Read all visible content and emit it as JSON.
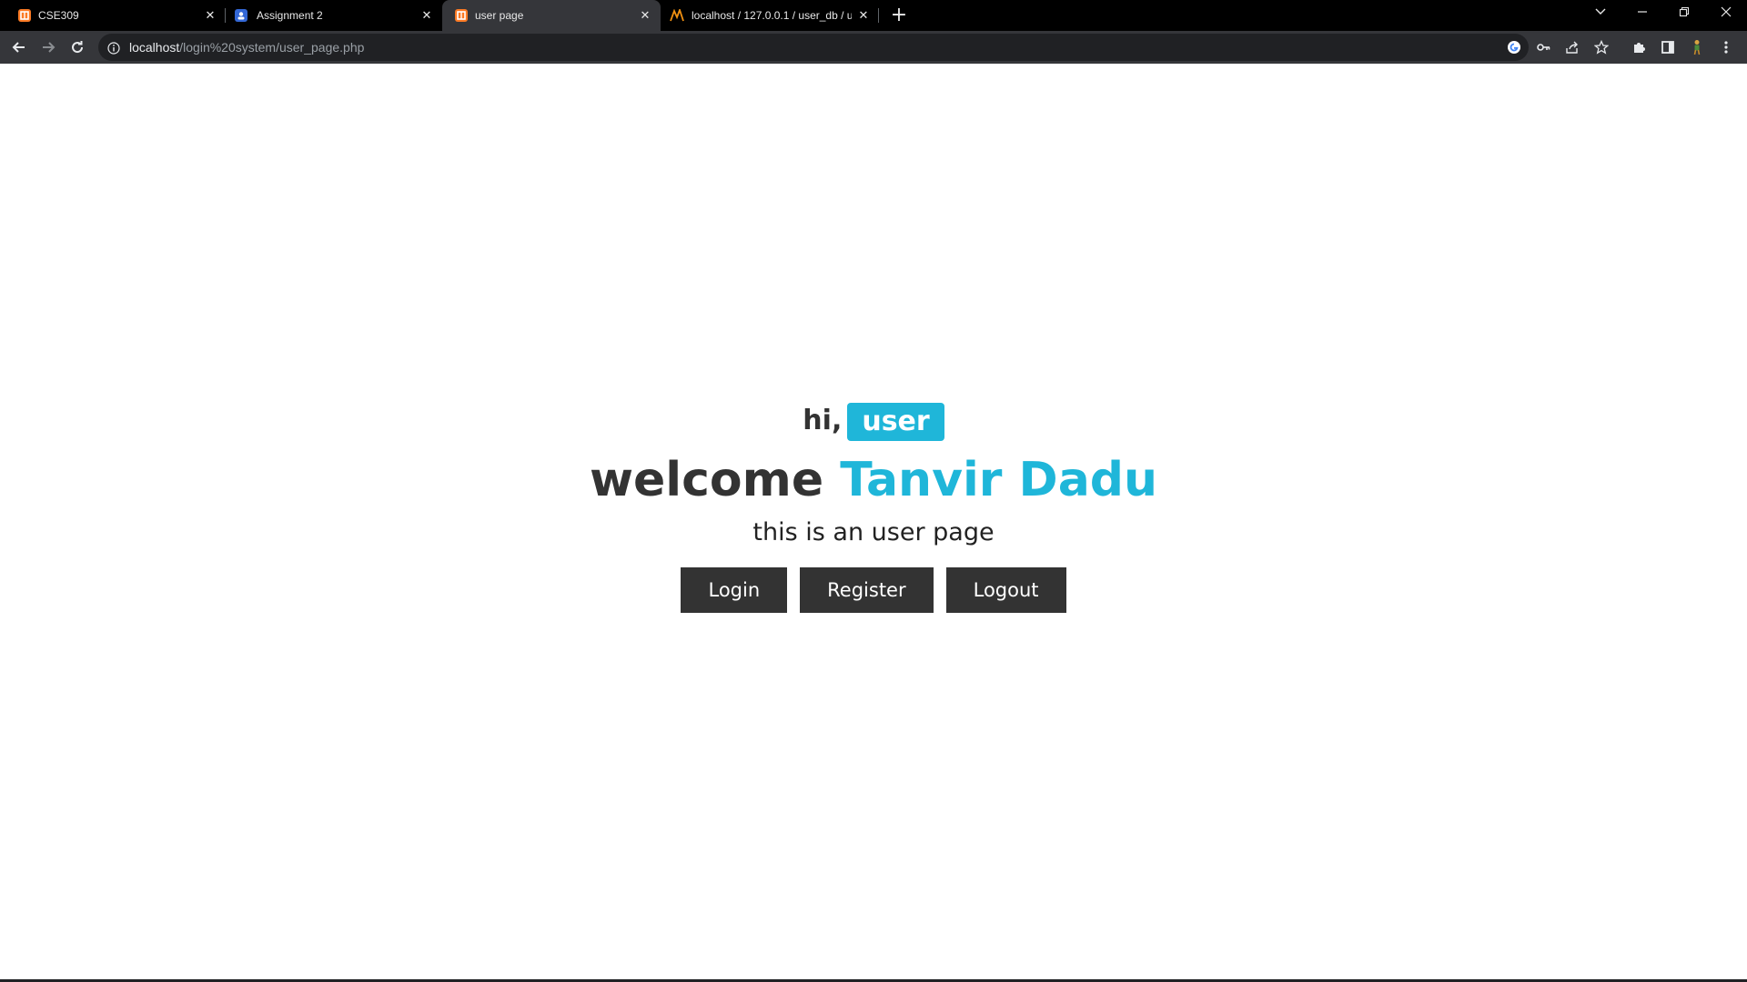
{
  "browser": {
    "tabs": [
      {
        "title": "CSE309",
        "icon": "xampp-icon",
        "active": false
      },
      {
        "title": "Assignment 2",
        "icon": "classroom-icon",
        "active": false
      },
      {
        "title": "user page",
        "icon": "xampp-icon",
        "active": true
      },
      {
        "title": "localhost / 127.0.0.1 / user_db / u",
        "icon": "phpmyadmin-icon",
        "active": false
      }
    ],
    "new_tab": "+",
    "url_host": "localhost",
    "url_path": "/login%20system/user_page.php"
  },
  "colors": {
    "accent": "#1fb6d9",
    "dark_text": "#333333",
    "button_bg": "#333333"
  },
  "page": {
    "greeting": "hi,",
    "role_badge": "user",
    "welcome_word": "welcome",
    "user_name": "Tanvir Dadu",
    "subtitle": "this is an user page",
    "buttons": {
      "login": "Login",
      "register": "Register",
      "logout": "Logout"
    }
  }
}
